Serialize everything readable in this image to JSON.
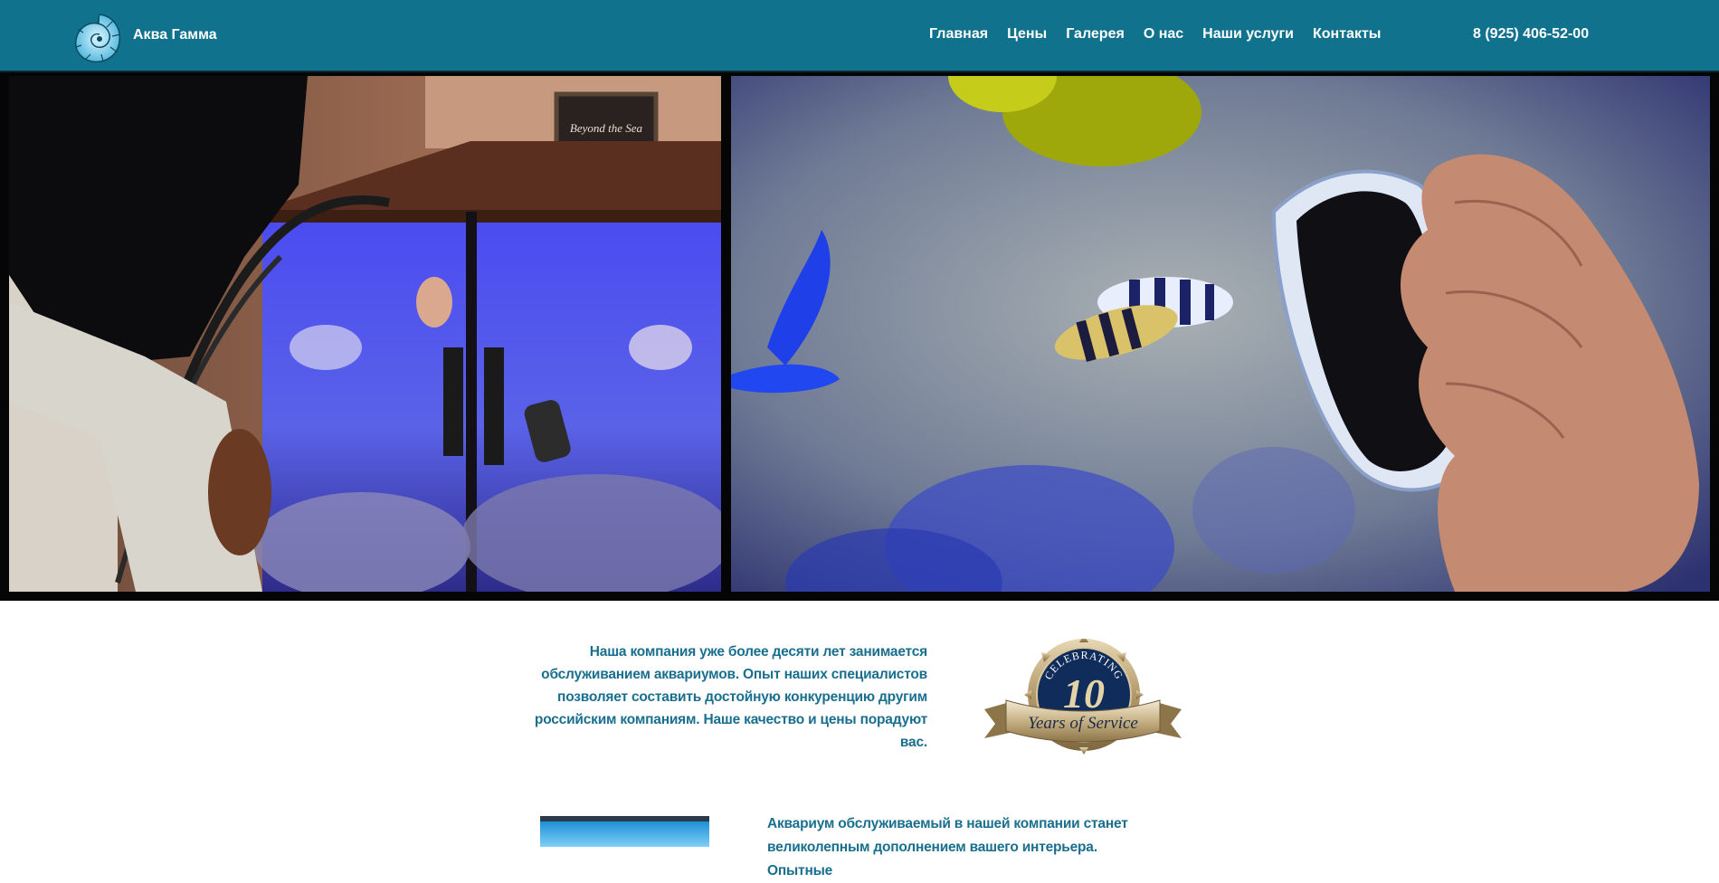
{
  "brand": {
    "name": "Аква Гамма",
    "logo_icon": "nautilus-shell-icon"
  },
  "nav": {
    "items": [
      {
        "label": "Главная"
      },
      {
        "label": "Цены"
      },
      {
        "label": "Галерея"
      },
      {
        "label": "О нас"
      },
      {
        "label": "Наши услуги"
      },
      {
        "label": "Контакты"
      }
    ]
  },
  "contact": {
    "phone": "8 (925) 406-52-00"
  },
  "hero": {
    "left_image": "aquarium-service-photo",
    "right_image": "magnet-cleaner-photo",
    "left_sign_text": "Beyond the Sea"
  },
  "intro": {
    "text": "Наша компания уже более десяти лет занимается обслуживанием аквариумов. Опыт наших специалистов позволяет составить достойную конкуренцию другим российским компаниям. Наше качество и цены порадуют вас."
  },
  "badge": {
    "top_text": "CELEBRATING",
    "number": "10",
    "ribbon_text": "Years of Service"
  },
  "section2": {
    "text": "Аквариум обслуживаемый в нашей компании станет великолепным дополнением вашего интерьера. Опытные"
  },
  "colors": {
    "header_bg": "#11728e",
    "accent_text": "#1a6f8e",
    "gold": "#b49a6a",
    "navy": "#0f2c5a"
  }
}
